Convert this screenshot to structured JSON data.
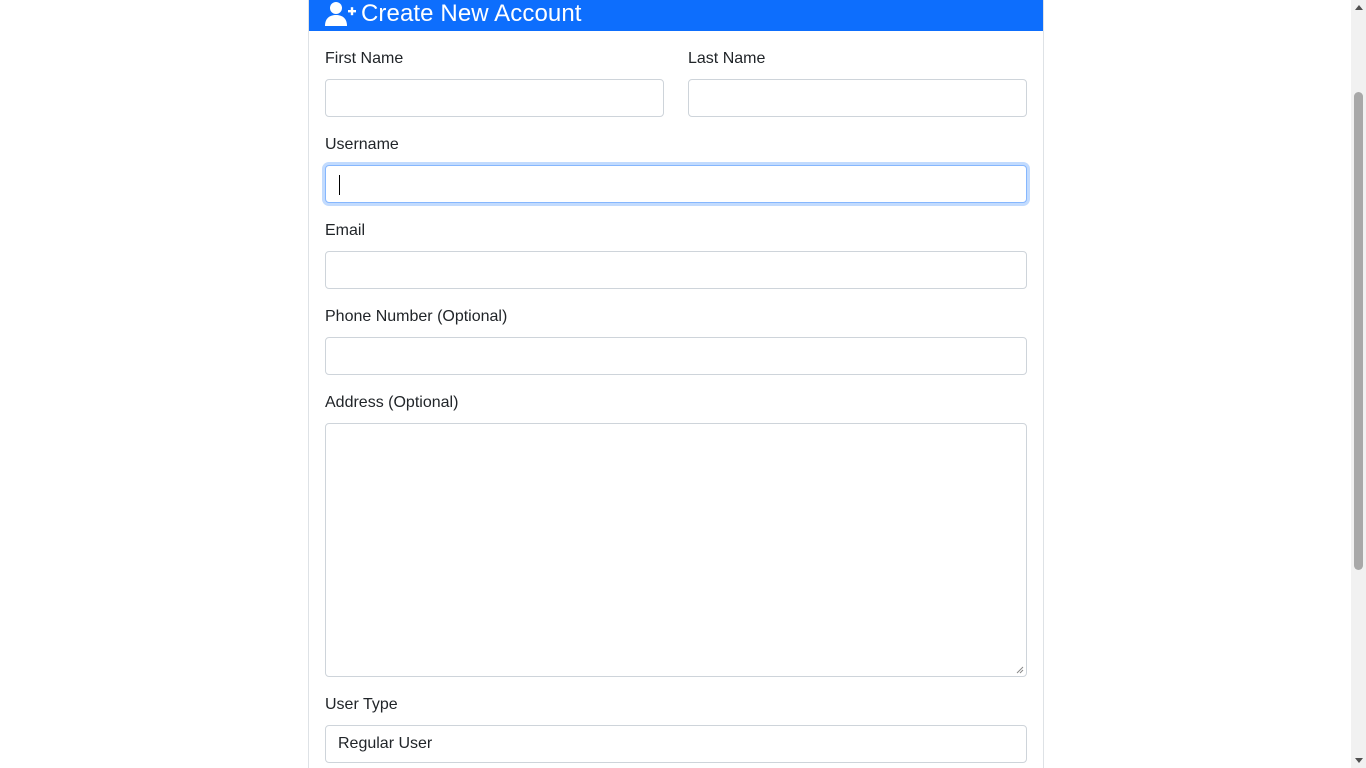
{
  "header": {
    "title": "Create New Account",
    "icon": "user-plus-icon",
    "color": "#0d6efd"
  },
  "form": {
    "first_name": {
      "label": "First Name",
      "value": ""
    },
    "last_name": {
      "label": "Last Name",
      "value": ""
    },
    "username": {
      "label": "Username",
      "value": ""
    },
    "email": {
      "label": "Email",
      "value": ""
    },
    "phone": {
      "label": "Phone Number (Optional)",
      "value": ""
    },
    "address": {
      "label": "Address (Optional)",
      "value": ""
    },
    "user_type": {
      "label": "User Type",
      "selected": "Regular User"
    }
  },
  "colors": {
    "accent": "#0d6efd",
    "focus_border": "#86b7fe",
    "input_border": "#ced4da"
  }
}
